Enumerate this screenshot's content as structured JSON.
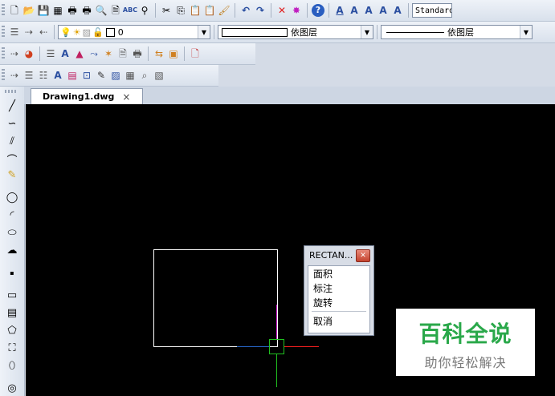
{
  "toolbar": {
    "text_style": "Standard",
    "layer_value": "0",
    "linetype_label": "依图层",
    "lineweight_label": "依图层"
  },
  "document_tab": {
    "label": "Drawing1.dwg",
    "close_glyph": "×"
  },
  "popup": {
    "title": "RECTAN...",
    "items": [
      "面积",
      "标注",
      "旋转",
      "取消"
    ]
  },
  "watermark": {
    "title": "百科全说",
    "subtitle": "助你轻松解决"
  },
  "colors": {
    "canvas": "#000000",
    "rectangle": "#ffffff",
    "crosshair_x": "#ff2020",
    "crosshair_y": "#20c020",
    "crosshair_accent": "#d020d0",
    "watermark_green": "#2aa84a"
  }
}
